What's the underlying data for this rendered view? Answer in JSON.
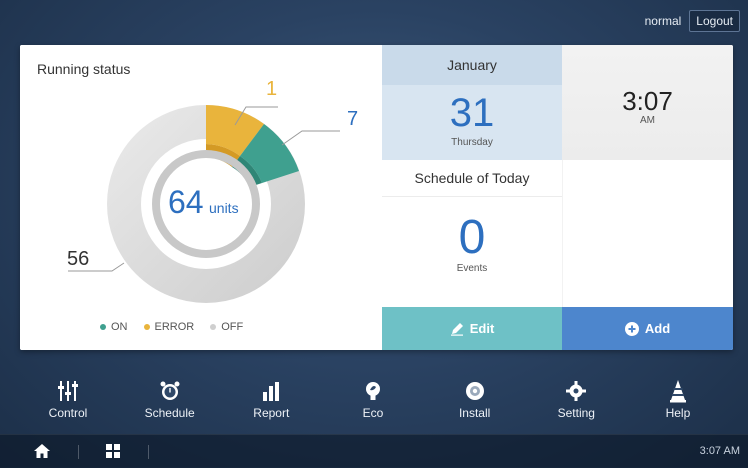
{
  "header": {
    "user": "normal",
    "logout_label": "Logout"
  },
  "running_status": {
    "title": "Running status",
    "total": "64",
    "unit": "units",
    "on_count": "7",
    "error_count": "1",
    "off_count": "56",
    "legend": {
      "on": "ON",
      "error": "ERROR",
      "off": "OFF"
    },
    "colors": {
      "on": "#3fa08f",
      "error": "#e9b43c",
      "off": "#d3d3d3",
      "accent_blue": "#2d6fbf"
    }
  },
  "calendar": {
    "month": "January",
    "day": "31",
    "weekday": "Thursday"
  },
  "clock": {
    "time": "3:07",
    "ampm": "AM"
  },
  "schedule": {
    "title": "Schedule of Today",
    "count": "0",
    "label": "Events",
    "edit_label": "Edit",
    "add_label": "Add"
  },
  "nav": {
    "items": [
      {
        "label": "Control",
        "icon": "sliders-icon"
      },
      {
        "label": "Schedule",
        "icon": "alarm-clock-icon"
      },
      {
        "label": "Report",
        "icon": "bar-chart-icon"
      },
      {
        "label": "Eco",
        "icon": "leaf-bulb-icon"
      },
      {
        "label": "Install",
        "icon": "gear-circle-icon"
      },
      {
        "label": "Setting",
        "icon": "gear-icon"
      },
      {
        "label": "Help",
        "icon": "cone-icon"
      }
    ]
  },
  "bottom": {
    "time": "3:07 AM"
  }
}
